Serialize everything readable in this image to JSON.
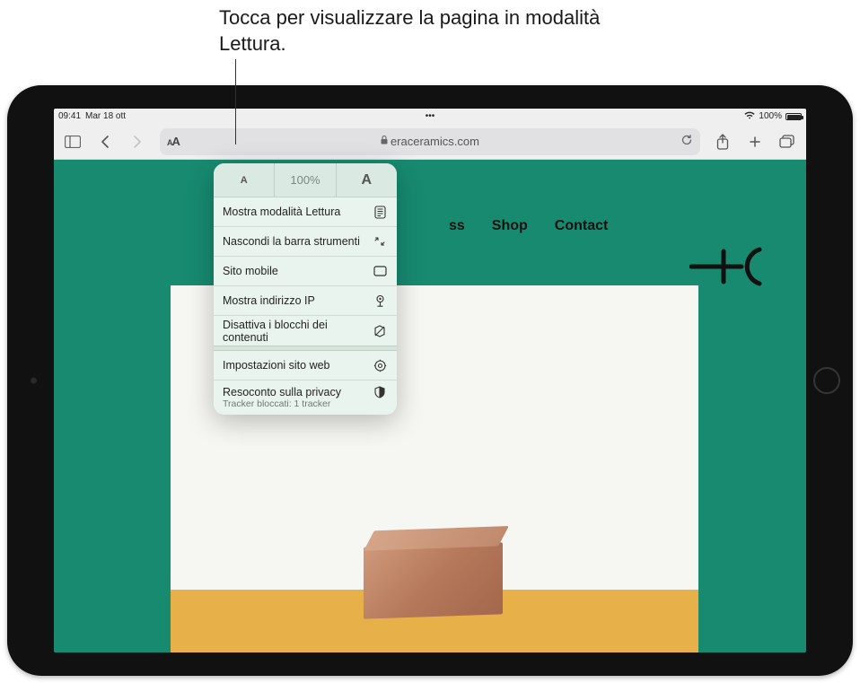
{
  "callout": {
    "text": "Tocca per visualizzare la pagina in modalità Lettura."
  },
  "status": {
    "time": "09:41",
    "date": "Mar 18 ott",
    "multitask": "•••",
    "wifi": "wifi",
    "battery_pct": "100%"
  },
  "toolbar": {
    "aa_label": "AA",
    "address": "eraceramics.com"
  },
  "popover": {
    "zoom_pct": "100%",
    "items_a": [
      {
        "label": "Mostra modalità Lettura",
        "icon": "reader-icon"
      },
      {
        "label": "Nascondi la barra strumenti",
        "icon": "collapse-icon"
      },
      {
        "label": "Sito mobile",
        "icon": "mobile-site-icon"
      },
      {
        "label": "Mostra indirizzo IP",
        "icon": "ip-icon"
      },
      {
        "label": "Disattiva i blocchi dei contenuti",
        "icon": "blockers-off-icon"
      }
    ],
    "items_b": [
      {
        "label": "Impostazioni sito web",
        "icon": "settings-icon"
      },
      {
        "label": "Resoconto sulla privacy",
        "icon": "privacy-icon",
        "sub": "Tracker bloccati: 1 tracker"
      }
    ]
  },
  "page": {
    "nav": {
      "process": "ss",
      "shop": "Shop",
      "contact": "Contact"
    }
  }
}
